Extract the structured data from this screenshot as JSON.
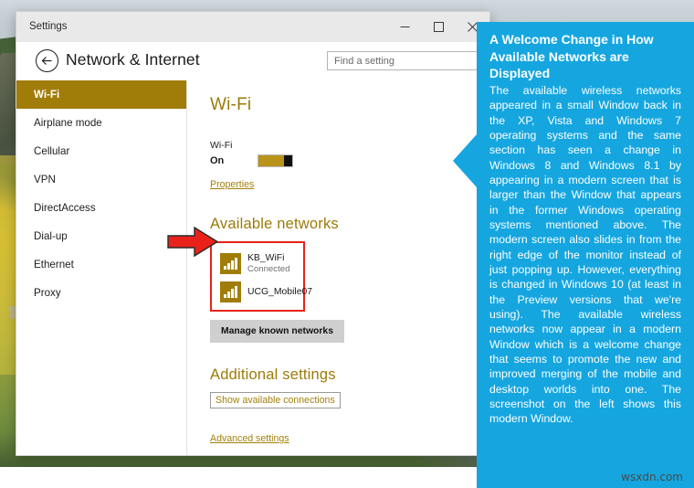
{
  "window": {
    "title": "Settings",
    "controls": {
      "minimize": "minimize-button",
      "maximize": "maximize-button",
      "close": "close-button"
    }
  },
  "header": {
    "back_label": "back",
    "page_title": "Network & Internet",
    "search": {
      "placeholder": "Find a setting",
      "value": ""
    }
  },
  "sidebar": {
    "items": [
      {
        "label": "Wi-Fi",
        "selected": true
      },
      {
        "label": "Airplane mode",
        "selected": false
      },
      {
        "label": "Cellular",
        "selected": false
      },
      {
        "label": "VPN",
        "selected": false
      },
      {
        "label": "DirectAccess",
        "selected": false
      },
      {
        "label": "Dial-up",
        "selected": false
      },
      {
        "label": "Ethernet",
        "selected": false
      },
      {
        "label": "Proxy",
        "selected": false
      }
    ]
  },
  "content": {
    "heading": "Wi-Fi",
    "wifi_label": "Wi-Fi",
    "wifi_state": "On",
    "properties_link": "Properties",
    "available_networks_heading": "Available networks",
    "networks": [
      {
        "ssid": "KB_WiFi",
        "status": "Connected",
        "signal_bars": 4
      },
      {
        "ssid": "UCG_Mobile07",
        "status": "",
        "signal_bars": 4
      }
    ],
    "manage_button": "Manage known networks",
    "additional_settings_heading": "Additional settings",
    "show_connections_link": "Show available connections",
    "advanced_settings_link": "Advanced settings"
  },
  "callout": {
    "title": "A Welcome Change in How Available Networks are Displayed",
    "body": "The available wireless networks appeared in a small Window back in the XP, Vista and Windows 7 operating systems and the same section has seen a change in Windows 8 and Windows 8.1 by appearing in a modern screen that is larger than the Window that appears in the former Windows operating systems mentioned above. The modern screen also slides in from the right edge of the monitor instead of just popping up. However, everything is changed in Windows 10 (at least in the Preview versions that we're using). The available wireless networks now appear in a modern Window which is a welcome change that seems to promote the new and improved merging of the mobile and desktop worlds into one. The screenshot on the left shows this modern Window."
  },
  "watermark": "wsxdn.com",
  "colors": {
    "accent_gold": "#a07c09",
    "callout_blue": "#15a6e0",
    "highlight_red": "#e8221b",
    "link_gold": "#a4810a"
  }
}
